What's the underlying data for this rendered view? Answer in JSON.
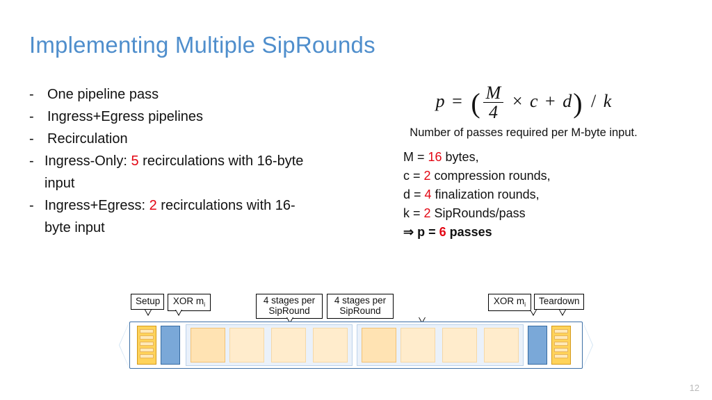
{
  "title": "Implementing Multiple SipRounds",
  "bullets": {
    "b1": "One pipeline pass",
    "b2": "Ingress+Egress pipelines",
    "b3": "Recirculation",
    "b3a_pre": "Ingress-Only: ",
    "b3a_num": "5",
    "b3a_post": " recirculations with 16-byte input",
    "b3b_pre": "Ingress+Egress: ",
    "b3b_num": "2",
    "b3b_post": " recirculations with 16-byte input"
  },
  "formula": {
    "p": "p",
    "eq": "=",
    "M": "M",
    "four": "4",
    "times": "×",
    "c": "c",
    "plus": "+",
    "d": "d",
    "slash": "/",
    "k": "k"
  },
  "caption": "Number of passes required per M-byte input.",
  "params": {
    "r1a": "M = ",
    "r1n": "16",
    "r1b": " bytes,",
    "r2a": "c = ",
    "r2n": "2",
    "r2b": " compression rounds,",
    "r3a": "d = ",
    "r3n": "4",
    "r3b": " finalization rounds,",
    "r4a": "k = ",
    "r4n": "2",
    "r4b": " SipRounds/pass",
    "r5a": "⇒ p = ",
    "r5n": "6",
    "r5b": " passes"
  },
  "pipeline": {
    "setup": "Setup",
    "xor": "XOR m",
    "xor_sub": "i",
    "sip": "4 stages per SipRound",
    "teardown": "Teardown"
  },
  "pagenum": "12"
}
